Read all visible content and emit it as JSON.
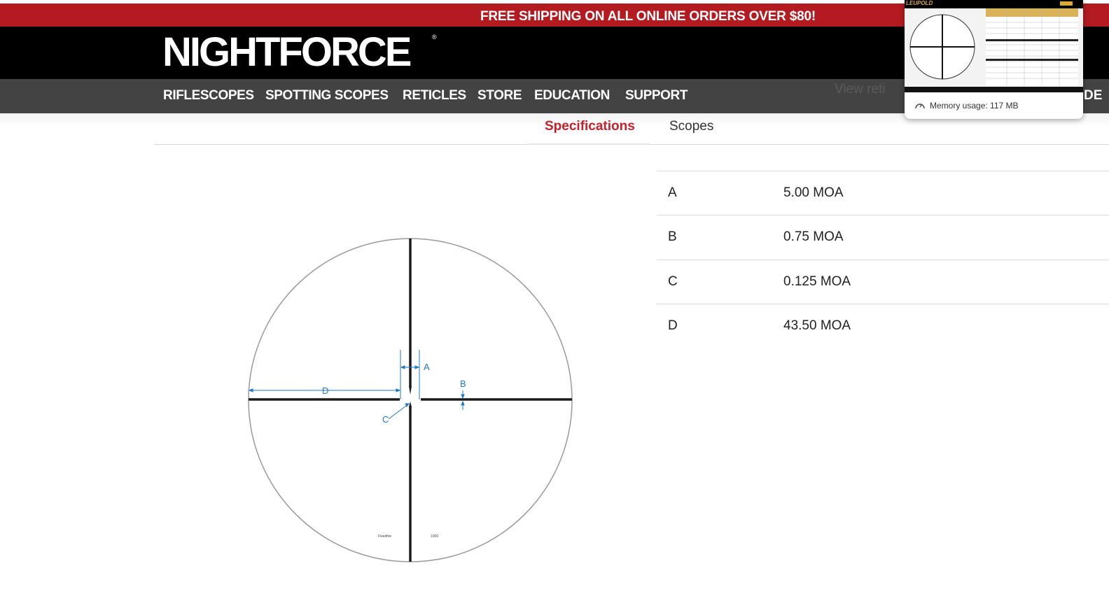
{
  "promo": {
    "text": "FREE SHIPPING ON ALL ONLINE ORDERS OVER $80!"
  },
  "header": {
    "logo": "NIGHTFORCE",
    "logo_mark": "®"
  },
  "nav": {
    "items": [
      {
        "label": "RIFLESCOPES"
      },
      {
        "label": "SPOTTING SCOPES"
      },
      {
        "label": "RETICLES"
      },
      {
        "label": "STORE"
      },
      {
        "label": "EDUCATION"
      },
      {
        "label": "SUPPORT"
      }
    ],
    "ghost_link": "View reti",
    "cut_off_item": "DE"
  },
  "tabs": [
    {
      "label": "Specifications",
      "active": true
    },
    {
      "label": "Scopes",
      "active": false
    }
  ],
  "specs": [
    {
      "key": "A",
      "value": "5.00 MOA"
    },
    {
      "key": "B",
      "value": "0.75 MOA"
    },
    {
      "key": "C",
      "value": "0.125 MOA"
    },
    {
      "key": "D",
      "value": "43.50 MOA"
    }
  ],
  "reticle": {
    "labels": {
      "a": "A",
      "b": "B",
      "c": "C",
      "d": "D"
    },
    "footer_left": "Fixedfire",
    "footer_right": "1000",
    "dimension_color": "#1f78c8",
    "line_color": "#1a1a1a"
  },
  "tab_popup": {
    "brand": "LEUPOLD",
    "memory": "Memory usage: 117 MB",
    "memory_icon": "gauge-icon"
  },
  "colors": {
    "promo_red": "#b31b21",
    "active_tab": "#c8202a",
    "nav_bg": "#434343"
  }
}
